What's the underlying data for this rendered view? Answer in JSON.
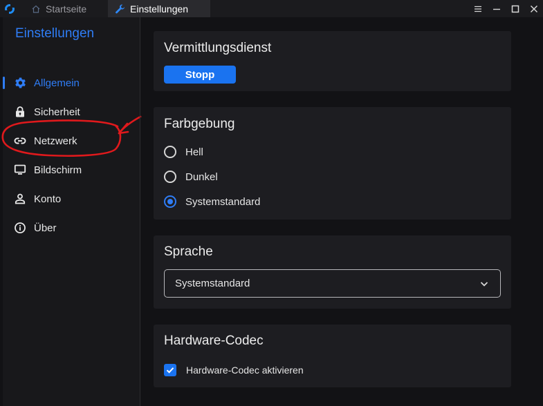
{
  "titlebar": {
    "tabs": [
      {
        "label": "Startseite",
        "icon": "home-icon"
      },
      {
        "label": "Einstellungen",
        "icon": "wrench-icon"
      }
    ],
    "controls": [
      "menu-icon",
      "minimize-icon",
      "maximize-icon",
      "close-icon"
    ]
  },
  "sidebar": {
    "title": "Einstellungen",
    "items": [
      {
        "label": "Allgemein",
        "icon": "gear-icon",
        "active": true
      },
      {
        "label": "Sicherheit",
        "icon": "lock-icon"
      },
      {
        "label": "Netzwerk",
        "icon": "link-icon"
      },
      {
        "label": "Bildschirm",
        "icon": "monitor-icon"
      },
      {
        "label": "Konto",
        "icon": "person-icon"
      },
      {
        "label": "Über",
        "icon": "info-icon"
      }
    ]
  },
  "main": {
    "service": {
      "title": "Vermittlungsdienst",
      "button_label": "Stopp"
    },
    "theme": {
      "title": "Farbgebung",
      "options": [
        {
          "label": "Hell",
          "checked": false
        },
        {
          "label": "Dunkel",
          "checked": false
        },
        {
          "label": "Systemstandard",
          "checked": true
        }
      ]
    },
    "language": {
      "title": "Sprache",
      "selected": "Systemstandard"
    },
    "codec": {
      "title": "Hardware-Codec",
      "checkbox_label": "Hardware-Codec aktivieren",
      "checked": true
    }
  },
  "colors": {
    "accent": "#2f7df6",
    "button": "#1a73f0",
    "annotation": "#e0191c"
  }
}
